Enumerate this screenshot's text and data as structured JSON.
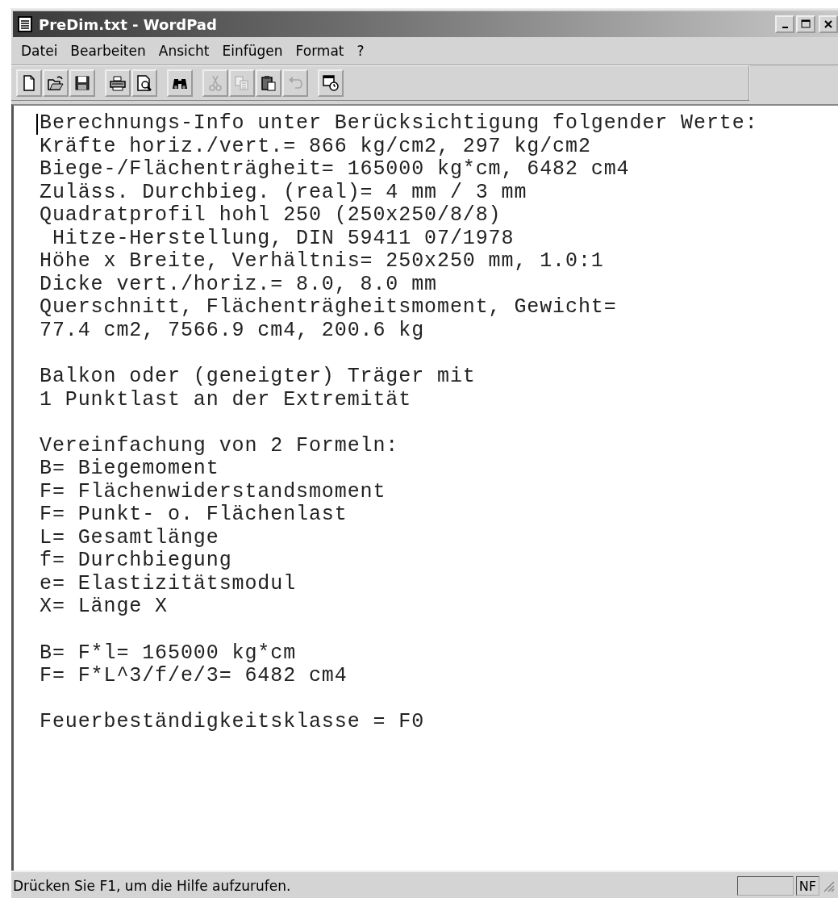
{
  "window": {
    "title": "PreDim.txt - WordPad"
  },
  "menu": [
    "Datei",
    "Bearbeiten",
    "Ansicht",
    "Einfügen",
    "Format",
    "?"
  ],
  "toolbar": [
    [
      {
        "kind": "new",
        "disabled": false
      },
      {
        "kind": "open",
        "disabled": false
      },
      {
        "kind": "save",
        "disabled": false
      }
    ],
    [
      {
        "kind": "print",
        "disabled": false
      },
      {
        "kind": "preview",
        "disabled": false
      }
    ],
    [
      {
        "kind": "find",
        "disabled": false
      }
    ],
    [
      {
        "kind": "cut",
        "disabled": true
      },
      {
        "kind": "copy",
        "disabled": true
      },
      {
        "kind": "paste",
        "disabled": false
      },
      {
        "kind": "undo",
        "disabled": true
      }
    ],
    [
      {
        "kind": "datetime",
        "disabled": false
      }
    ]
  ],
  "document": {
    "paragraphs": [
      [
        "Berechnungs-Info unter Berücksichtigung folgender Werte:",
        "Kräfte horiz./vert.= 866 kg/cm2, 297 kg/cm2",
        "Biege-/Flächenträgheit= 165000 kg*cm, 6482 cm4",
        "Zuläss. Durchbieg. (real)= 4 mm / 3 mm",
        "Quadratprofil hohl 250 (250x250/8/8)",
        " Hitze-Herstellung, DIN 59411 07/1978",
        "Höhe x Breite, Verhältnis= 250x250 mm, 1.0:1",
        "Dicke vert./horiz.= 8.0, 8.0 mm",
        "Querschnitt, Flächenträgheitsmoment, Gewicht=",
        "77.4 cm2, 7566.9 cm4, 200.6 kg"
      ],
      [
        "Balkon oder (geneigter) Träger mit",
        "1 Punktlast an der Extremität"
      ],
      [
        "Vereinfachung von 2 Formeln:",
        "B= Biegemoment",
        "F= Flächenwiderstandsmoment",
        "F= Punkt- o. Flächenlast",
        "L= Gesamtlänge",
        "f= Durchbiegung",
        "e= Elastizitätsmodul",
        "X= Länge X"
      ],
      [
        "B= F*l= 165000 kg*cm",
        "F= F*L^3/f/e/3= 6482 cm4"
      ],
      [
        "Feuerbeständigkeitsklasse = F0"
      ]
    ]
  },
  "status_bar": {
    "text": "Drücken Sie F1, um die Hilfe aufzurufen.",
    "indicator": "NF"
  }
}
